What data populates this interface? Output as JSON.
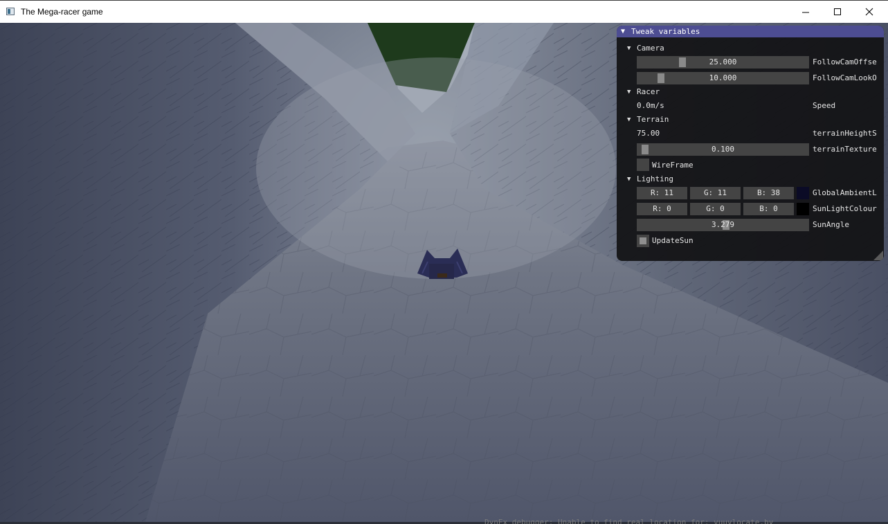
{
  "window": {
    "title": "The Mega-racer game",
    "icons": {
      "app": "app-window-icon",
      "minimize": "minimize-icon",
      "maximize": "maximize-icon",
      "close": "close-icon"
    }
  },
  "tweak_panel": {
    "title": "Tweak variables",
    "sections": {
      "camera": {
        "label": "Camera",
        "follow_cam_offset": {
          "value": "25.000",
          "label": "FollowCamOffse",
          "fraction": 0.25
        },
        "follow_cam_look": {
          "value": "10.000",
          "label": "FollowCamLookO",
          "fraction": 0.12
        }
      },
      "racer": {
        "label": "Racer",
        "speed": {
          "value": "0.0m/s",
          "label": "Speed"
        }
      },
      "terrain": {
        "label": "Terrain",
        "height_scale": {
          "value": "75.00",
          "label": "terrainHeightS"
        },
        "texture": {
          "value": "0.100",
          "label": "terrainTexture",
          "fraction": 0.02
        },
        "wireframe": {
          "label": "WireFrame",
          "checked": false
        }
      },
      "lighting": {
        "label": "Lighting",
        "global_ambient": {
          "r": "R: 11",
          "g": "G: 11",
          "b": "B: 38",
          "label": "GlobalAmbientL",
          "color": "#0b0b26"
        },
        "sun_light": {
          "r": "R:  0",
          "g": "G:  0",
          "b": "B:  0",
          "label": "SunLightColour",
          "color": "#000000"
        },
        "sun_angle": {
          "value": "3.279",
          "label": "SunAngle",
          "fraction": 0.52
        },
        "update_sun": {
          "label": "UpdateSun",
          "checked": true
        }
      }
    }
  },
  "colors": {
    "panel_header": "#4d4d92",
    "panel_bg": "#121214",
    "slider_bg": "#444444",
    "slider_grab": "#8a8a8a",
    "fog": "#8a93a3",
    "grass": "#1e3a1c",
    "racer": "#2a2d55"
  },
  "console": {
    "partial_text": "DynEx debugger: Unable to find real location for: vuuvlocate.by"
  }
}
